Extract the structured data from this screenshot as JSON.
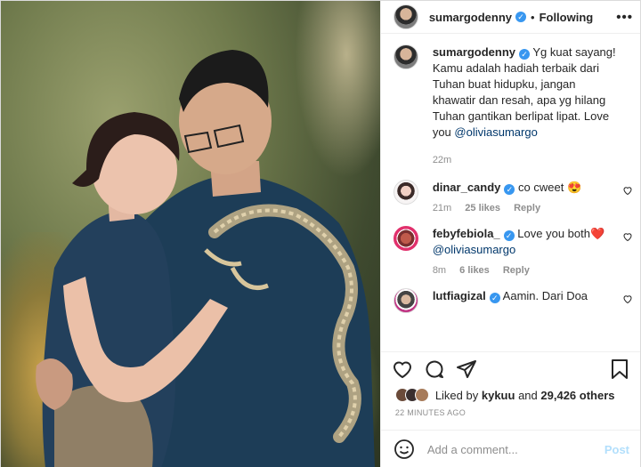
{
  "header": {
    "username": "sumargodenny",
    "separator": "•",
    "follow_state": "Following",
    "more": "•••"
  },
  "caption": {
    "username": "sumargodenny",
    "text": "Yg kuat sayang! Kamu adalah hadiah terbaik dari Tuhan buat hidupku, jangan khawatir dan resah, apa yg hilang Tuhan gantikan berlipat lipat. Love you",
    "mention": "@oliviasumargo",
    "time": "22m"
  },
  "comments": [
    {
      "username": "dinar_candy",
      "text": "co cweet 😍",
      "mention": "",
      "time": "21m",
      "likes": "25 likes",
      "reply": "Reply"
    },
    {
      "username": "febyfebiola_",
      "text": "Love you both❤️",
      "mention": "@oliviasumargo",
      "time": "8m",
      "likes": "6 likes",
      "reply": "Reply"
    },
    {
      "username": "lutfiagizal",
      "text": "Aamin. Dari Doa",
      "mention": "",
      "time": "",
      "likes": "",
      "reply": ""
    }
  ],
  "likes": {
    "prefix": "Liked by",
    "user": "kykuu",
    "and": "and",
    "others": "29,426 others"
  },
  "timestamp": "22 MINUTES AGO",
  "add_comment": {
    "placeholder": "Add a comment...",
    "post_label": "Post"
  },
  "colors": {
    "verified": "#3897f0",
    "mention": "#00376b",
    "post_disabled": "#b2dffc",
    "muted": "#8e8e8e"
  },
  "icons": [
    "more-icon",
    "verified-icon",
    "heart-icon",
    "comment-icon",
    "share-icon",
    "bookmark-icon",
    "emoji-icon"
  ]
}
